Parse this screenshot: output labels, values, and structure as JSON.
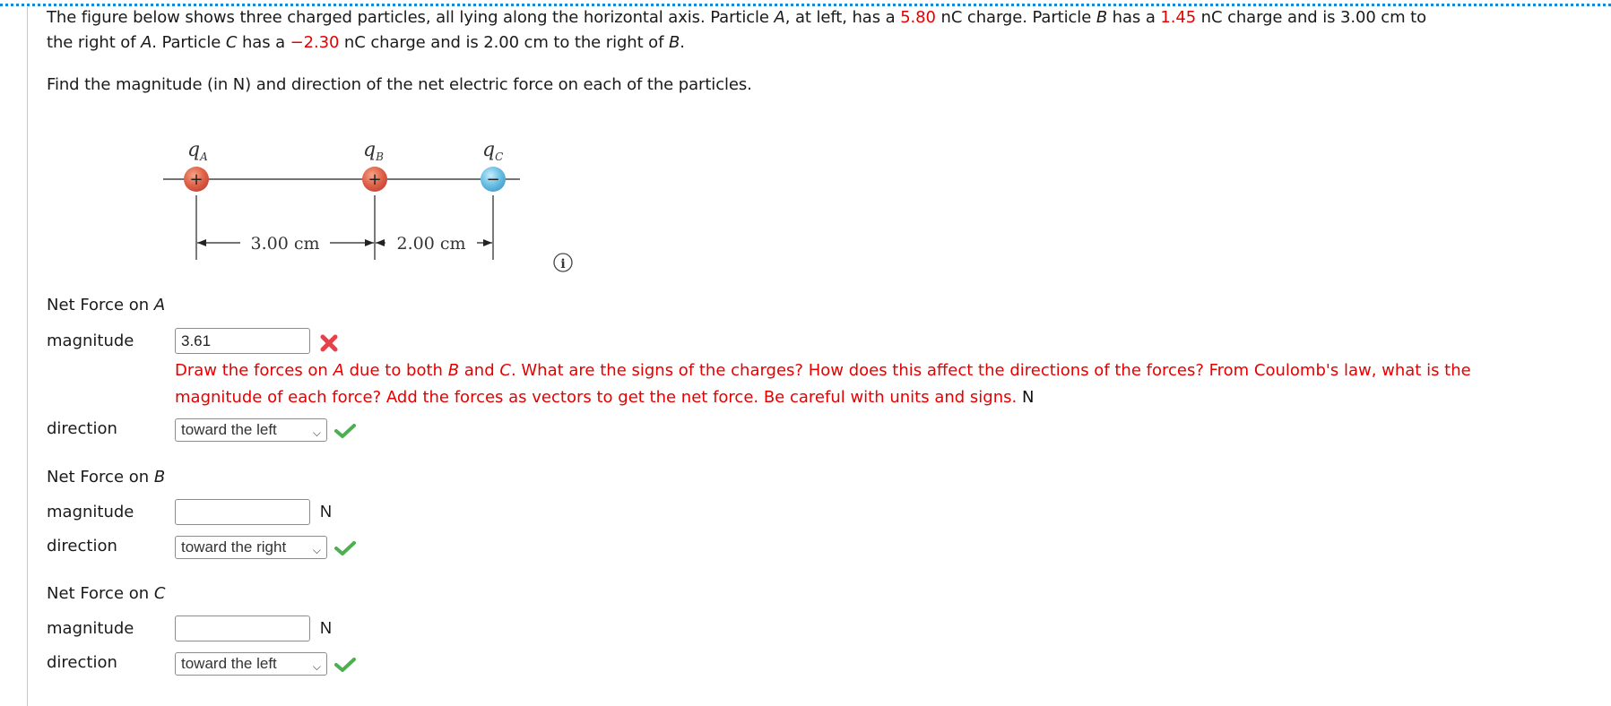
{
  "problem": {
    "line1_parts": [
      {
        "t": "The figure below shows three charged particles, all lying along the horizontal axis. Particle "
      },
      {
        "t": "A",
        "i": true
      },
      {
        "t": ", at left, has a "
      },
      {
        "t": "5.80",
        "r": true
      },
      {
        "t": " nC charge. Particle "
      },
      {
        "t": "B",
        "i": true
      },
      {
        "t": " has a "
      },
      {
        "t": "1.45",
        "r": true
      },
      {
        "t": " nC charge and is 3.00 cm to"
      }
    ],
    "line2_parts": [
      {
        "t": "the right of "
      },
      {
        "t": "A",
        "i": true
      },
      {
        "t": ". Particle "
      },
      {
        "t": "C",
        "i": true
      },
      {
        "t": " has a "
      },
      {
        "t": "−2.30",
        "r": true
      },
      {
        "t": " nC charge and is 2.00 cm to the right of "
      },
      {
        "t": "B",
        "i": true
      },
      {
        "t": "."
      }
    ],
    "question": "Find the magnitude (in N) and direction of the net electric force on each of the particles.",
    "charges": {
      "A": "5.80",
      "B": "1.45",
      "C": "−2.30"
    }
  },
  "figure": {
    "labels": {
      "A": "q",
      "A_sub": "A",
      "B": "q",
      "B_sub": "B",
      "C": "q",
      "C_sub": "C"
    },
    "signs": {
      "A": "+",
      "B": "+",
      "C": "−"
    },
    "distance_AB": "3.00 cm",
    "distance_BC": "2.00 cm",
    "colors": {
      "positive": "#e0644a",
      "negative": "#6cc0e4"
    },
    "info_icon": "i"
  },
  "sections": [
    {
      "heading_prefix": "Net Force on ",
      "heading_var": "A",
      "magnitude_label": "magnitude",
      "magnitude_value": "3.61",
      "magnitude_status": "incorrect",
      "hint_line1_parts": [
        {
          "t": "Draw the forces on "
        },
        {
          "t": "A",
          "i": true
        },
        {
          "t": " due to both "
        },
        {
          "t": "B",
          "i": true
        },
        {
          "t": " and "
        },
        {
          "t": "C",
          "i": true
        },
        {
          "t": ". What are the signs of the charges? How does this affect the directions of the forces? From Coulomb's law, what is the"
        }
      ],
      "hint_line2": "magnitude of each force? Add the forces as vectors to get the net force. Be careful with units and signs.",
      "unit": "N",
      "direction_label": "direction",
      "direction_value": "toward the left",
      "direction_status": "correct"
    },
    {
      "heading_prefix": "Net Force on ",
      "heading_var": "B",
      "magnitude_label": "magnitude",
      "magnitude_value": "",
      "unit": "N",
      "direction_label": "direction",
      "direction_value": "toward the right",
      "direction_status": "correct"
    },
    {
      "heading_prefix": "Net Force on ",
      "heading_var": "C",
      "magnitude_label": "magnitude",
      "magnitude_value": "",
      "unit": "N",
      "direction_label": "direction",
      "direction_value": "toward the left",
      "direction_status": "correct"
    }
  ],
  "colors": {
    "highlight_red": "#e60000",
    "correct_green": "#4caf50",
    "incorrect_red": "#e8404a",
    "border_blue": "#1a86d6"
  }
}
